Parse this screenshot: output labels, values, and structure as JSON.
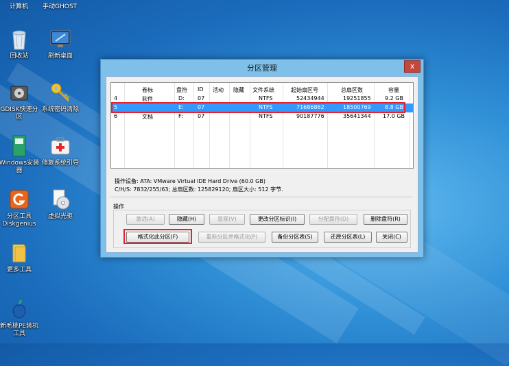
{
  "desktop": {
    "top_labels": [
      "计算机",
      "手动GHOST"
    ],
    "icons": [
      {
        "label": "回收站",
        "icon": "recycle-bin-icon"
      },
      {
        "label": "刷新桌面",
        "icon": "refresh-desktop-icon"
      },
      {
        "label": "GDISK快速分区",
        "icon": "gdisk-icon"
      },
      {
        "label": "系统密码清除",
        "icon": "key-icon"
      },
      {
        "label": "Windows安装器",
        "icon": "windows-installer-icon"
      },
      {
        "label": "修复系统引导",
        "icon": "first-aid-icon"
      },
      {
        "label": "分区工具Diskgenius",
        "icon": "diskgenius-icon"
      },
      {
        "label": "虚拟光驱",
        "icon": "virtual-cd-icon"
      },
      {
        "label": "更多工具",
        "icon": "folder-icon"
      },
      {
        "label": "新毛桃PE装机工具",
        "icon": "peach-icon"
      }
    ]
  },
  "window": {
    "title": "分区管理",
    "close_label": "x",
    "columns": [
      "卷标",
      "盘符",
      "ID",
      "活动",
      "隐藏",
      "文件系统",
      "起始扇区号",
      "总扇区数",
      "容量"
    ],
    "rows": [
      {
        "num": "4",
        "label": "软件",
        "drive": "D:",
        "id": "07",
        "active": "",
        "hidden": "",
        "fs": "NTFS",
        "start": "52434944",
        "total": "19251855",
        "size": "9.2 GB",
        "selected": false
      },
      {
        "num": "5",
        "label": "",
        "drive": "E:",
        "id": "07",
        "active": "",
        "hidden": "",
        "fs": "NTFS",
        "start": "71686862",
        "total": "18500769",
        "size": "8.8 GB",
        "selected": true
      },
      {
        "num": "6",
        "label": "文档",
        "drive": "F:",
        "id": "07",
        "active": "",
        "hidden": "",
        "fs": "NTFS",
        "start": "90187776",
        "total": "35641344",
        "size": "17.0 GB",
        "selected": false
      }
    ],
    "info_line1": "操作设备:  ATA: VMware Virtual IDE Hard Drive (60.0 GB)",
    "info_line2": "C/H/S: 7832/255/63; 总扇区数: 125829120; 扇区大小: 512 字节.",
    "operations_label": "操作",
    "buttons": {
      "activate": "激活(A)",
      "hide": "隐藏(H)",
      "show": "显现(V)",
      "change_id": "更改分区标识(I)",
      "assign_letter": "分配盘符(D)",
      "delete_letter": "删除盘符(R)",
      "format": "格式化此分区(F)",
      "repartition": "重新分区并格式化(P)",
      "backup": "备份分区表(S)",
      "restore": "还原分区表(L)",
      "close": "关闭(C)"
    }
  },
  "colors": {
    "selection": "#3399ff",
    "highlight_box": "#e8202a",
    "window_frame": "#7ec0ea"
  }
}
